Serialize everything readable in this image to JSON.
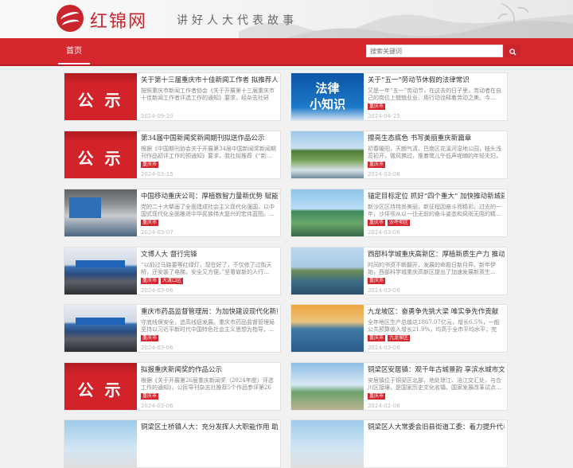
{
  "site": {
    "logo_text": "红锦网",
    "slogan": "讲好人大代表故事"
  },
  "nav": {
    "home": "首页"
  },
  "search": {
    "placeholder": "搜索关键词"
  },
  "articles": [
    {
      "title": "关于第十三届重庆市十佳新闻工作者 拟推荐人选的公示",
      "summary": "按照重庆市新闻工作者协会《关于开展第十三届重庆市十佳新闻工作者评选工作的通知》要求，经杂志社研究…",
      "tags": [],
      "date": "2024-09-20",
      "thumb": "gongshi"
    },
    {
      "title": "关于“五一”劳动节休假的法律常识",
      "summary": "又是一年“五一”劳动节，在这去的日子里，劳动者在自己的岗位上兢兢业业、用行动诠释着劳动之美。今…",
      "tags": [
        "重庆市"
      ],
      "date": "2024-04-25",
      "thumb": "law"
    },
    {
      "title": "第34届中国新闻奖新闻期刊拟送作品公示",
      "summary": "根据《中国期刊协会关于开展第34届中国新闻奖新闻期刊作品初评工作的预通知》要求，我社拟推荐《“新…",
      "tags": [
        "重庆市"
      ],
      "date": "2024-03-15",
      "thumb": "gongshi"
    },
    {
      "title": "擦亮生态底色 书写美丽重庆新篇章",
      "summary": "初春暖阳，天朗气清。巴南区花溪河湿地公园，枝头浅蕊初开，微风拂过，推着鹭儿午低声呢喃的年轻夫妇，牵伴徒走…",
      "tags": [
        "重庆市"
      ],
      "date": "2024-03-08",
      "thumb": "river"
    },
    {
      "title": "中国移动重庆公司：厚植数智力量新优势 赋能新质生产力",
      "summary": "党的二十大擘画了全面建成社会主义现代化强国、以中国式现代化全面推进中华民族伟大复兴的宏伟蓝图。…",
      "tags": [
        "重庆市"
      ],
      "date": "2024-03-07",
      "thumb": "expo"
    },
    {
      "title": "锚定目标定位 抓好“四个重大” 加快推动新城建设",
      "summary": "新沙区区持持尚美丽，新征程因奋斗而精彩。过去的一年，沙坪坝从以一往无前的奋斗姿态和风雨无阻的精…",
      "tags": [
        "重庆市",
        "沙坪坝区"
      ],
      "date": "2024-03-06",
      "thumb": "city"
    },
    {
      "title": "文博人大 督行完锋",
      "summary": "“以前过马路要等红绿灯，现在好了，不仅修了过街天桥，还安装了电梯，安全又方便。”坚看崭新的人行…",
      "tags": [
        "重庆市",
        "大渡口区"
      ],
      "date": "2024-03-06",
      "thumb": "meeting"
    },
    {
      "title": "西部科学城重庆高新区：厚植新质生产力 推动高质量发展",
      "summary": "时间的书页不断翻开，发展的命题日新月异。新年伊始，西部科学城重庆高新区提出了加速发展新质生…",
      "tags": [
        "重庆市"
      ],
      "date": "2024-03-06",
      "thumb": "riverscape"
    },
    {
      "title": "重庆市药品监督管理局：为加快建设现代化新重庆贡献药监力量",
      "summary": "守底线保安全，追高线促发展。重庆市药品监督管理局坚持以习近平新时代中国特色社会主义思想为指导，…",
      "tags": [
        "重庆市"
      ],
      "date": "2024-03-06",
      "thumb": "meeting"
    },
    {
      "title": "九龙坡区：奋勇争先挑大梁 唯实争先作贡献",
      "summary": "全年地区生产总值达1867.07亿元，增长6.5%，一般公共预算收入增长21.9%，均高于全市平均水平；完成…",
      "tags": [
        "重庆市",
        "九龙坡区"
      ],
      "date": "2024-03-06",
      "thumb": "sunset"
    },
    {
      "title": "拟报重庆新闻奖的作品公示",
      "summary": "根据《关于开展第26届重庆新闻奖（2024年度）评选工作的通知》，公民导刊杂志社推荐5个作品参评第26届…",
      "tags": [
        "重庆市"
      ],
      "date": "2024-03-06",
      "thumb": "gongshi"
    },
    {
      "title": "铜梁区安居镇：观千年古城景韵 享滨水城市文明",
      "summary": "安居镇位于铜梁区北部，地处琼江、涪江交汇处，与合川区接壤，是国家历史文化名镇、国家发展改革试点…",
      "tags": [
        "重庆市"
      ],
      "date": "2024-02-06",
      "thumb": "bridge"
    },
    {
      "title": "铜梁区土桥镇人大：充分发挥人大职能作用 助力乡村振兴",
      "summary": "",
      "tags": [],
      "date": "",
      "thumb": "town"
    },
    {
      "title": "铜梁区人大常委会旧县街道工委：着力提升代表履职能力",
      "summary": "",
      "tags": [],
      "date": "",
      "thumb": "town"
    }
  ]
}
